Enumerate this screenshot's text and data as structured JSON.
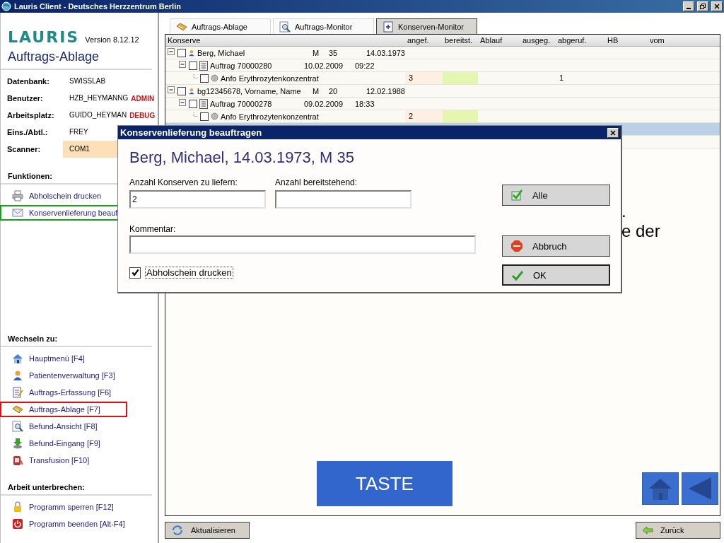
{
  "window": {
    "title": "Lauris Client - Deutsches Herzzentrum Berlin"
  },
  "sidebar": {
    "brand": "LAURIS",
    "version": "Version 8.12.12",
    "page_title": "Auftrags-Ablage",
    "info": [
      {
        "label": "Datenbank:",
        "value": "SWISSLAB"
      },
      {
        "label": "Benutzer:",
        "value": "HZB_HEYMANNG",
        "flag": "ADMIN"
      },
      {
        "label": "Arbeitsplatz:",
        "value": "GUIDO_HEYMAN",
        "flag": "DEBUG"
      },
      {
        "label": "Eins./Abtl.:",
        "value": "FREY"
      },
      {
        "label": "Scanner:",
        "value": "COM1",
        "highlighted": true
      }
    ],
    "sections": [
      {
        "title": "Funktionen:",
        "items": [
          {
            "label": "Abholschein drucken",
            "kind": "printer"
          },
          {
            "label": "Konservenlieferung beauf",
            "kind": "envelope",
            "color": "#1aa01a"
          }
        ]
      },
      {
        "title": "Wechseln zu:",
        "items": [
          {
            "label": "Hauptmenü [F4]",
            "kind": "home"
          },
          {
            "label": "Patientenverwaltung [F3]",
            "kind": "person"
          },
          {
            "label": "Auftrags-Erfassung [F6]",
            "kind": "form"
          },
          {
            "label": "Auftrags-Ablage [F7]",
            "kind": "tray",
            "color": "#e01010"
          },
          {
            "label": "Befund-Ansicht [F8]",
            "kind": "magnifier"
          },
          {
            "label": "Befund-Eingang [F9]",
            "kind": "download"
          },
          {
            "label": "Transfusion [F10]",
            "kind": "transfusion"
          }
        ]
      },
      {
        "title": "Arbeit unterbrechen:",
        "items": [
          {
            "label": "Programm sperren [F12]",
            "kind": "lock"
          },
          {
            "label": "Programm beenden [Alt-F4]",
            "kind": "power"
          }
        ]
      }
    ]
  },
  "tabs": [
    {
      "label": "Auftrags-Ablage",
      "kind": "tray",
      "selected": false
    },
    {
      "label": "Auftrags-Monitor",
      "kind": "magnifier",
      "selected": false
    },
    {
      "label": "Konserven-Monitor",
      "kind": "document",
      "selected": true
    }
  ],
  "table": {
    "columns": [
      "Konserve",
      "angef.",
      "bereitst.",
      "Ablauf",
      "ausgeg.",
      "abgeruf.",
      "HB",
      "vom"
    ],
    "rows": [
      {
        "kind": "patient",
        "name": "Berg,  Michael",
        "sex": "M",
        "age": "35",
        "dob": "14.03.1973",
        "expanded": true,
        "checked": false,
        "children": [
          {
            "kind": "order",
            "name": "Auftrag 70000280",
            "date": "10.02.2009",
            "time": "09:22",
            "expanded": true,
            "checked": false,
            "children": [
              {
                "kind": "request",
                "name": "Anfo Erythrozytenkonzentrat",
                "checked": false,
                "angef": "3",
                "abgeruf": "1"
              }
            ]
          }
        ]
      },
      {
        "kind": "patient",
        "name": "bg12345678,  Vorname, Name",
        "sex": "M",
        "age": "20",
        "dob": "12.02.1988",
        "expanded": true,
        "checked": false,
        "children": [
          {
            "kind": "order",
            "name": "Auftrag 70000278",
            "date": "09.02.2009",
            "time": "18:33",
            "expanded": true,
            "checked": false,
            "children": [
              {
                "kind": "request",
                "name": "Anfo Erythrozytenkonzentrat",
                "checked": false,
                "angef": "2"
              }
            ]
          }
        ]
      }
    ],
    "covered_rows": [
      {
        "selected": true
      },
      {
        "selected": false
      }
    ]
  },
  "background_text": [
    ".",
    "e der"
  ],
  "key_button": "TASTE",
  "footer": {
    "refresh": "Aktualisieren",
    "back": "Zurück"
  },
  "dialog": {
    "title": "Konservenlieferung beauftragen",
    "heading": "Berg, Michael, 14.03.1973, M 35",
    "fields": [
      {
        "label": "Anzahl Konserven zu liefern:",
        "value": "2"
      },
      {
        "label": "Anzahl bereitstehend:"
      }
    ],
    "comment": {
      "label": "Kommentar:"
    },
    "print_checkbox": {
      "label": "Abholschein drucken",
      "checked": true
    },
    "buttons": [
      {
        "label": "Alle",
        "kind": "all",
        "default": false
      },
      {
        "label": "Abbruch",
        "kind": "stop",
        "default": false
      },
      {
        "label": "OK",
        "kind": "ok",
        "default": true
      }
    ]
  }
}
